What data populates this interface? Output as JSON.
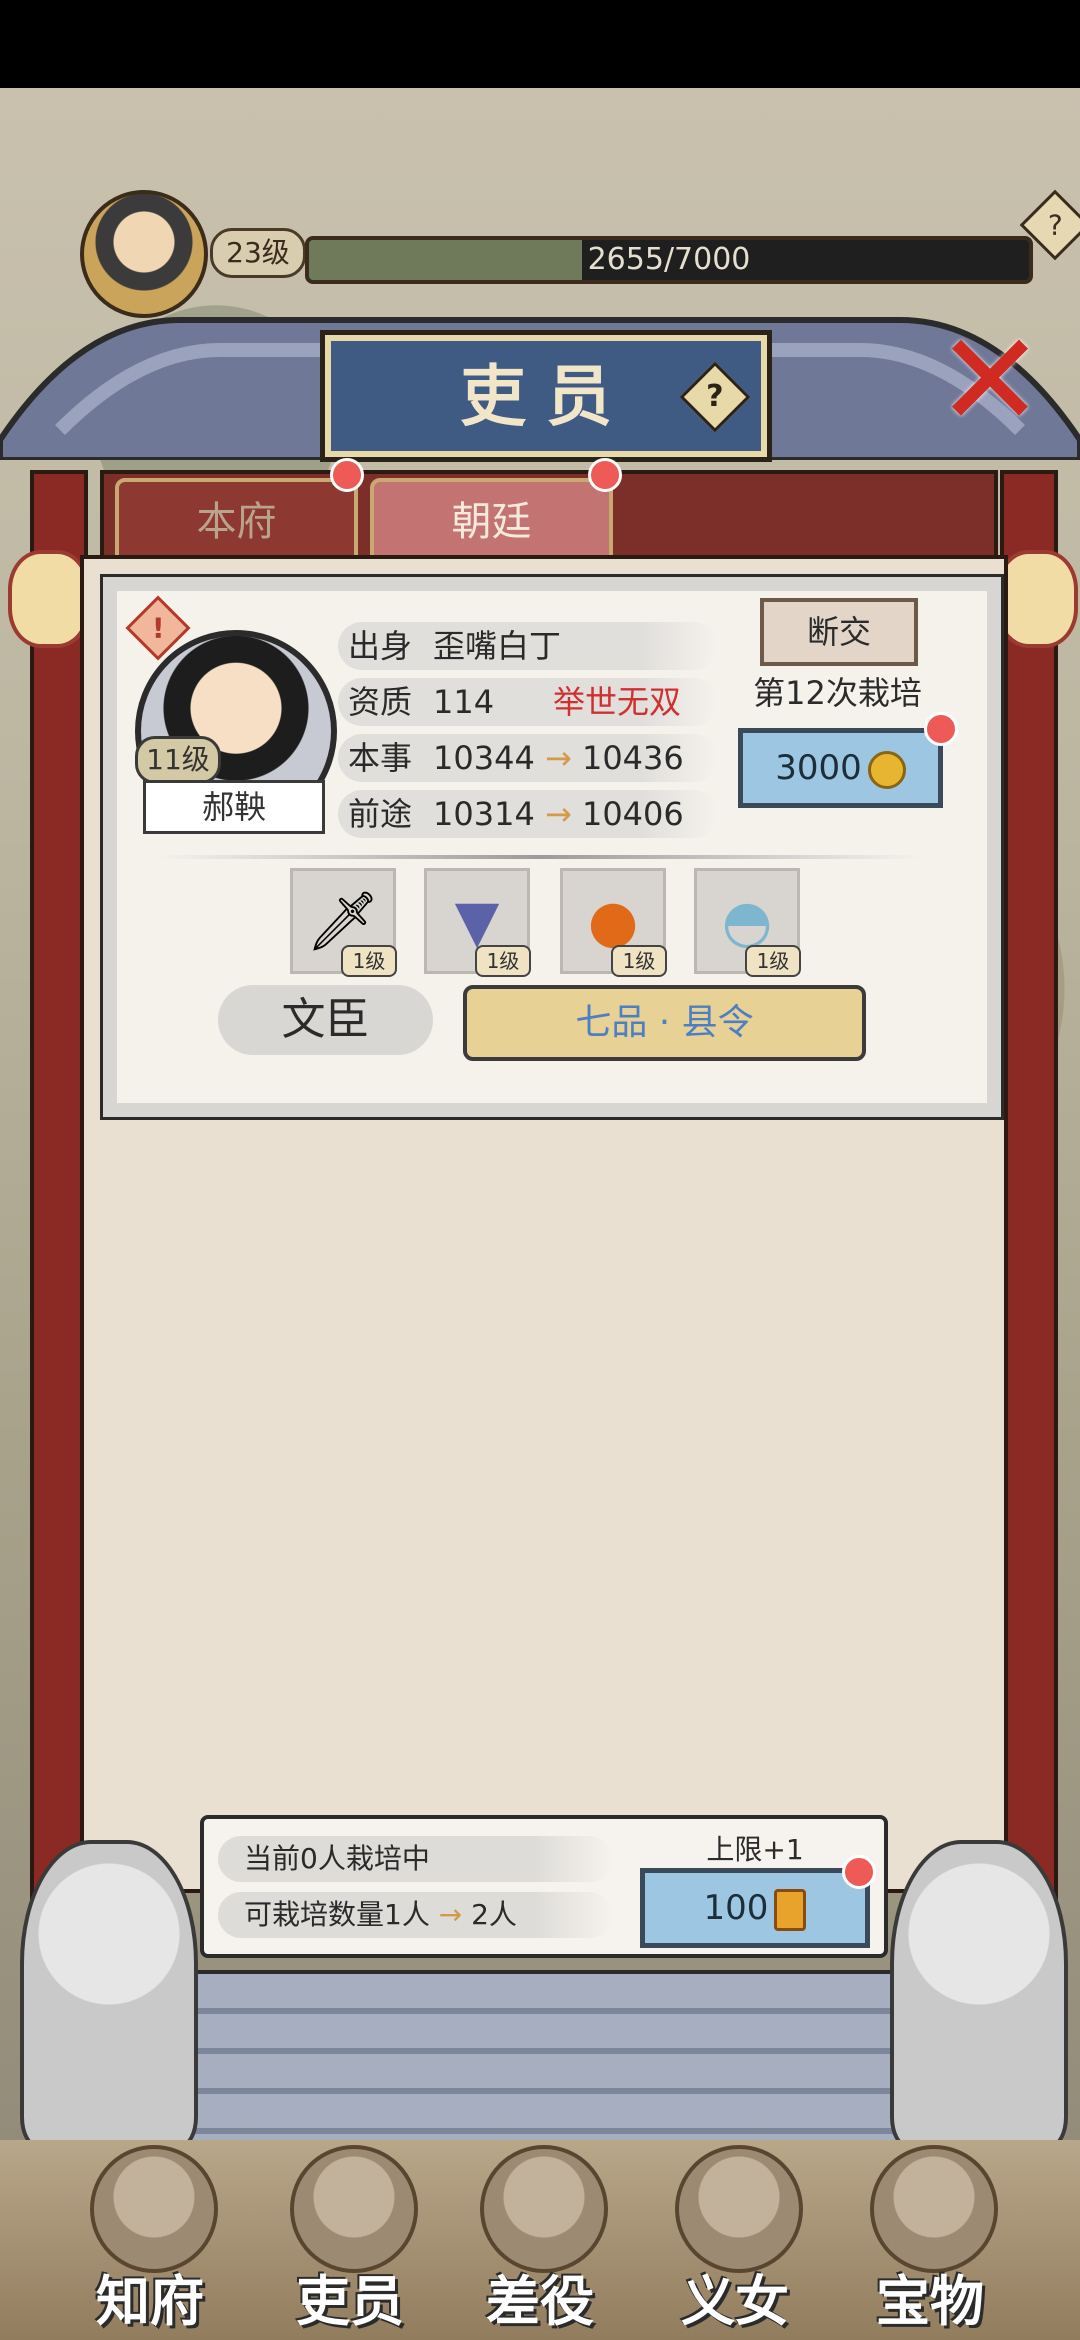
{
  "player": {
    "level": "23级",
    "exp_text": "2655/7000",
    "exp_fraction": 0.379
  },
  "title": {
    "text": "吏员",
    "help_icon": "question-icon",
    "close_icon": "close-x-icon"
  },
  "tabs": [
    {
      "label": "本府"
    },
    {
      "label": "朝廷"
    }
  ],
  "official": {
    "level": "11级",
    "name": "郝鞅",
    "origin_label": "出身",
    "origin_value": "歪嘴白丁",
    "quality_label": "资质",
    "quality_value": "114",
    "quality_grade": "举世无双",
    "ability_label": "本事",
    "ability_from": "10344",
    "ability_to": "10436",
    "prospect_label": "前途",
    "prospect_from": "10314",
    "prospect_to": "10406",
    "sever_label": "断交",
    "cultivate_count": "第12次栽培",
    "cost": "3000",
    "equipment": [
      {
        "icon": "sword-icon",
        "level": "1级"
      },
      {
        "icon": "robe-icon",
        "level": "1级"
      },
      {
        "icon": "jade-icon",
        "level": "1级"
      },
      {
        "icon": "bowl-icon",
        "level": "1级"
      }
    ],
    "category": "文臣",
    "rank": "七品 · 县令"
  },
  "bottom_info": {
    "current": "当前0人栽培中",
    "capacity_prefix": "可栽培数量1人",
    "capacity_to": "2人",
    "limit_label": "上限+1",
    "limit_cost": "100"
  },
  "nav": [
    {
      "label": "知府"
    },
    {
      "label": "吏员"
    },
    {
      "label": "差役"
    },
    {
      "label": "义女"
    },
    {
      "label": "宝物"
    }
  ],
  "colors": {
    "accent_red": "#d03030",
    "rank_blue": "#4e7fc4",
    "button_blue": "#9cc6e2"
  }
}
